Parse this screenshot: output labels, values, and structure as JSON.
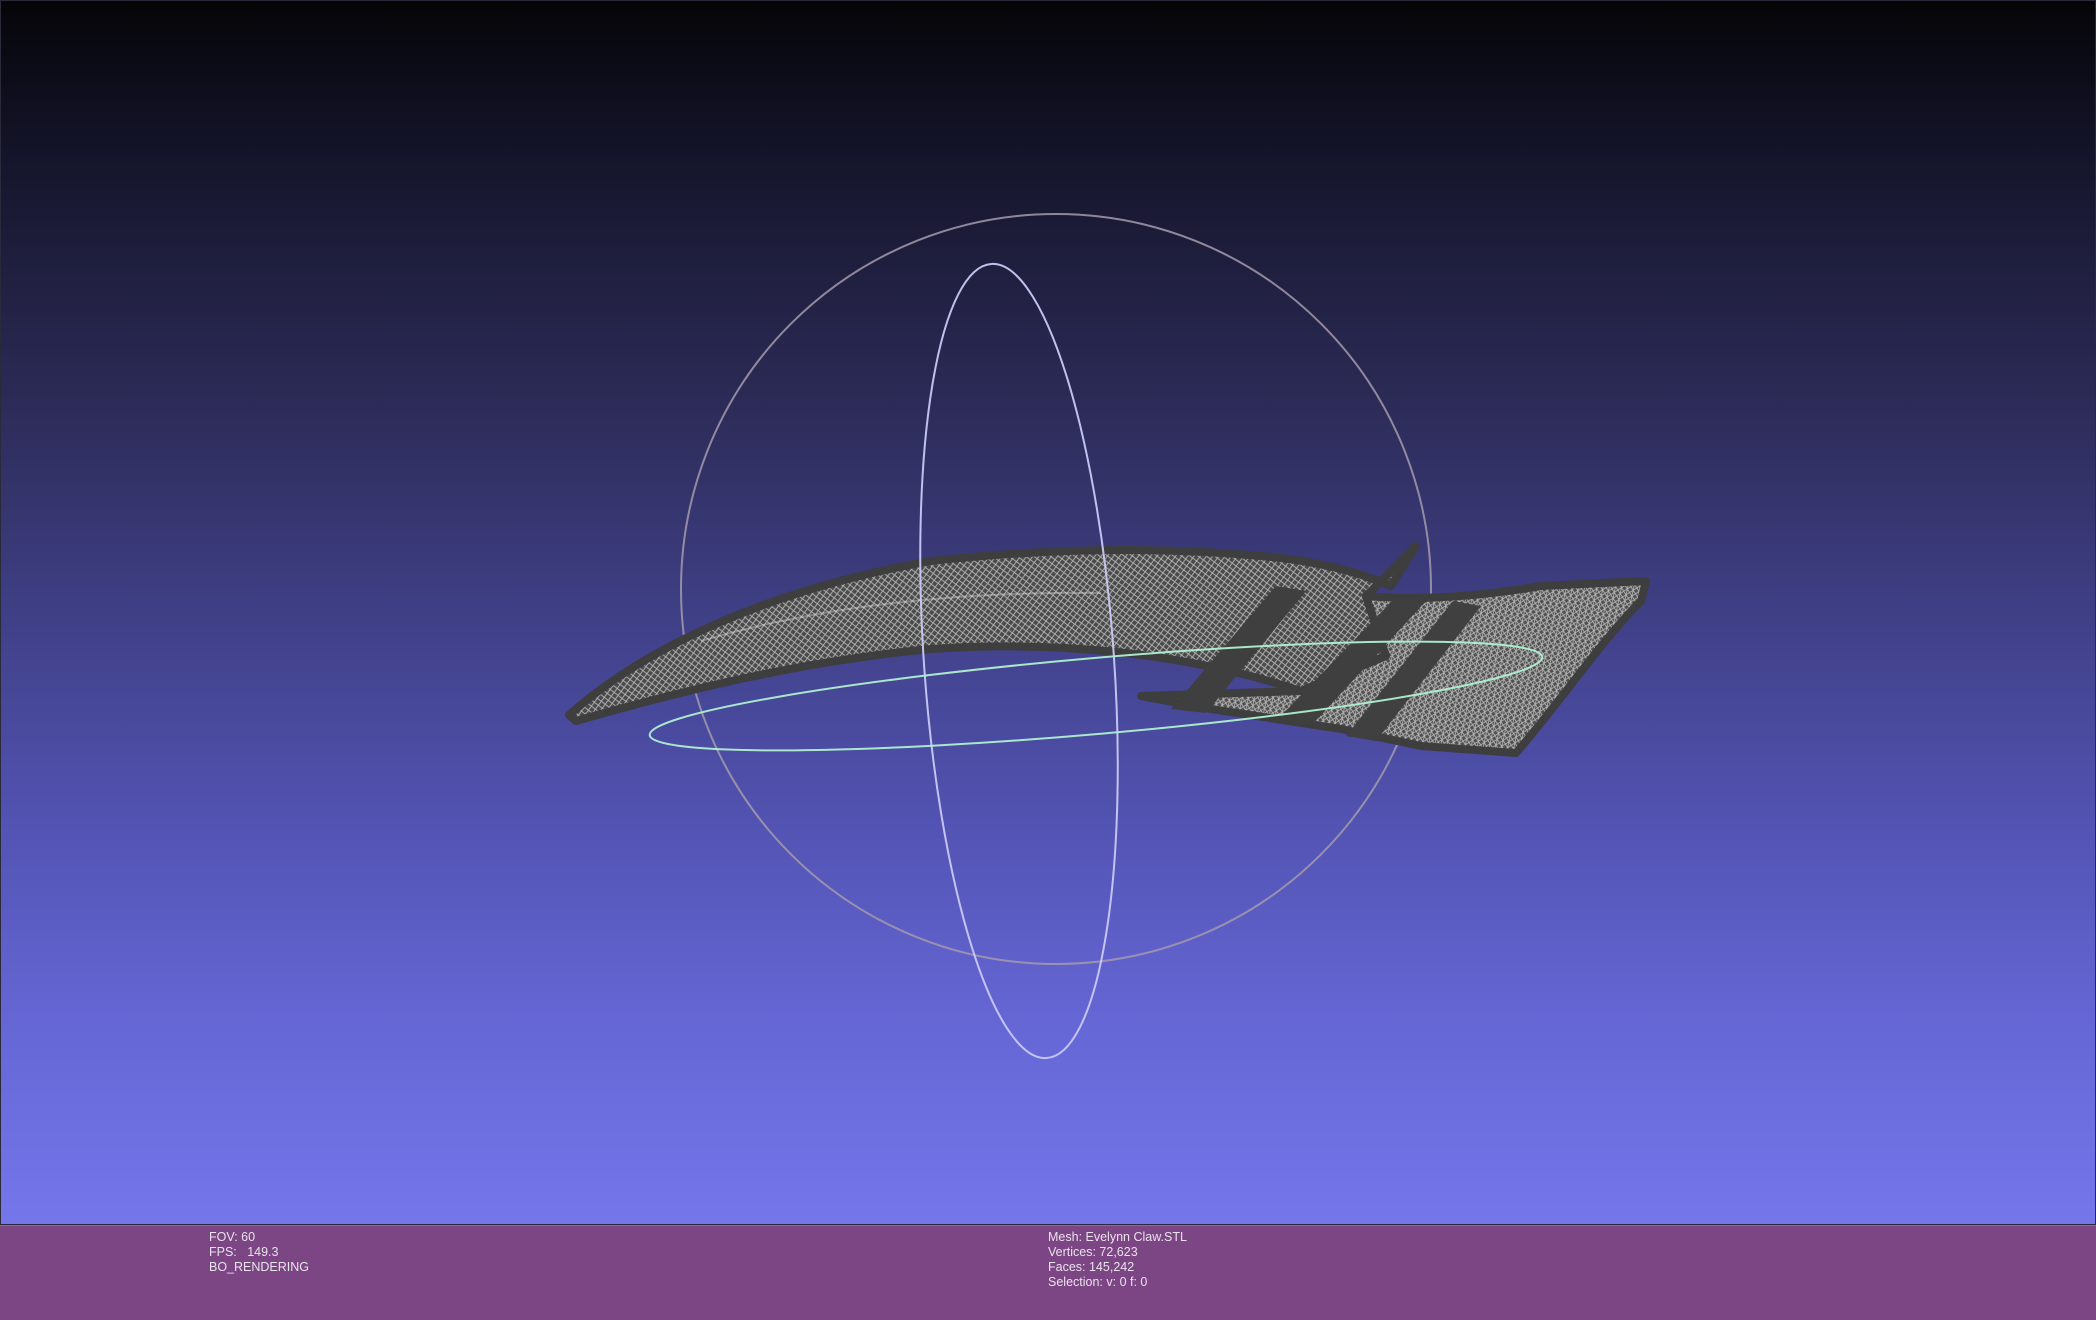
{
  "viewport": {
    "background_top_color": "#050508",
    "background_bottom_color": "#7476ea",
    "trackball_colors": {
      "sphere": "#a59aab",
      "vertical_ring": "#c9c9f5",
      "horizontal_ring": "#aef0d0"
    },
    "mesh_color": "#4a4a4a",
    "wireframe_color": "#d8d8d8"
  },
  "info_bar": {
    "background_color": "#7c4584",
    "left": {
      "fov": "FOV: 60",
      "fps": "FPS:   149.3",
      "render_mode": "BO_RENDERING"
    },
    "right": {
      "mesh": "Mesh: Evelynn Claw.STL",
      "vertices": "Vertices: 72,623",
      "faces": "Faces: 145,242",
      "selection": "Selection: v: 0 f: 0"
    }
  }
}
